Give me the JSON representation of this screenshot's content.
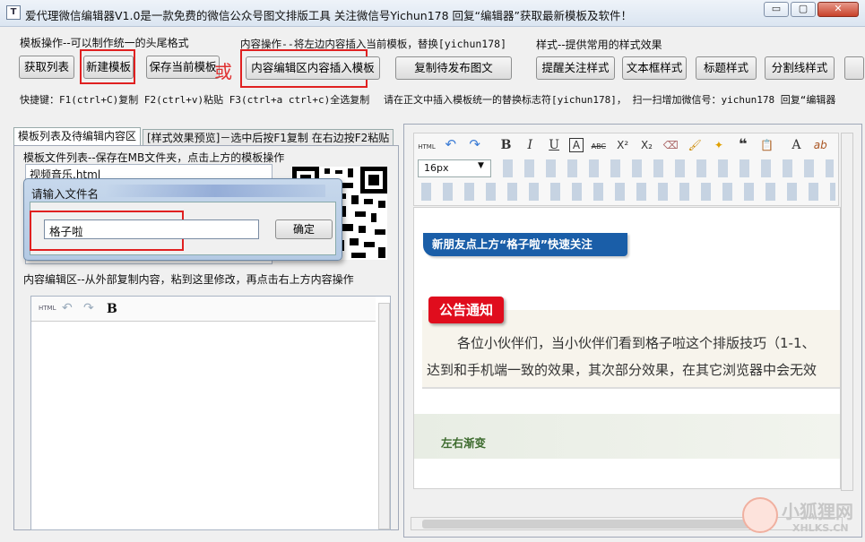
{
  "window": {
    "title": "爱代理微信编辑器V1.0是一款免费的微信公众号图文排版工具 关注微信号Yichun178 回复“编辑器”获取最新模板及软件！",
    "app_icon": "T",
    "btn_min": "▭",
    "btn_max": "▢",
    "btn_close": "✕"
  },
  "groups": {
    "template_ops": "模板操作--可以制作统一的头尾格式",
    "content_ops": "内容操作--将左边内容插入当前模板，替换[yichun178]",
    "style_ops": "样式--提供常用的样式效果"
  },
  "buttons": {
    "get_list": "获取列表",
    "new_template": "新建模板",
    "save_template": "保存当前模板",
    "or": "或",
    "insert_content": "内容编辑区内容插入模板",
    "copy_publish": "复制待发布图文",
    "remind_style": "提醒关注样式",
    "textbox_style": "文本框样式",
    "title_style": "标题样式",
    "divider_style": "分割线样式"
  },
  "hints": {
    "shortcut": "快捷键：F1(ctrl+C)复制  F2(ctrl+v)粘贴 F3(ctrl+a ctrl+c)全选复制",
    "insert_hint": "请在正文中插入模板统一的替换标志符[yichun178]，  扫一扫增加微信号：yichun178 回复“编辑器"
  },
  "tabs": {
    "tab1": "模板列表及待编辑内容区",
    "tab2": "[样式效果预览]－选中后按F1复制 在右边按F2粘贴"
  },
  "left": {
    "file_list_label": "模板文件列表--保存在MB文件夹，点击上方的模板操作",
    "file_item": "视频音乐.html",
    "editor_label": "内容编辑区--从外部复制内容，粘到这里修改，再点击右上方内容操作",
    "mini_html": "HTML",
    "mini_undo": "↶",
    "mini_redo": "↷",
    "mini_bold": "B"
  },
  "dialog": {
    "title": "请输入文件名",
    "value": "格子啦",
    "ok": "确定"
  },
  "toolbar": {
    "html": "HTML",
    "undo": "↶",
    "redo": "↷",
    "bold": "B",
    "italic": "I",
    "underline": "U",
    "fontcolor": "A",
    "strike": "ABC",
    "sup": "X²",
    "sub": "X₂",
    "eraser": "⌫",
    "brush": "🖌",
    "magic": "✦",
    "quote": "❝",
    "paste": "📋",
    "fontsize": "16px",
    "fontcolor2": "A",
    "highlight": "ab"
  },
  "preview": {
    "badge1": "新朋友点上方“格子啦”快速关注",
    "badge2": "公告通知",
    "para1": "各位小伙伴们，当小伙伴们看到格子啦这个排版技巧（1-1、",
    "para2": "达到和手机端一致的效果，其次部分效果，在其它浏览器中会无效",
    "section3": "左右渐变"
  },
  "watermark": {
    "cn": "小狐狸网",
    "en": "XHLKS.CN"
  },
  "colors": {
    "badge_blue": "#1a5ea8",
    "badge_red": "#e00d1d",
    "red_outline": "#e02020"
  }
}
